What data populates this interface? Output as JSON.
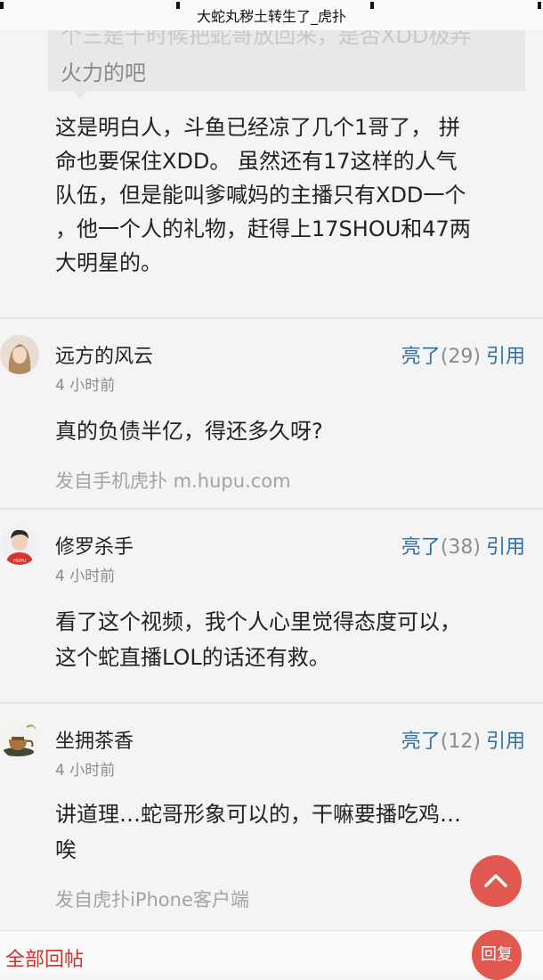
{
  "header": {
    "title": "大蛇丸秽土转生了_虎扑"
  },
  "quoted_post": {
    "faded_line": "个三是千时候把蛇哥放回来，是否XDD极弄",
    "visible_line": "火力的吧"
  },
  "main_reply": {
    "lines": [
      "这是明白人，斗鱼已经凉了几个1哥了， 拼",
      "命也要保住XDD。 虽然还有17这样的人气",
      "队伍，但是能叫爹喊妈的主播只有XDD一个",
      "，他一个人的礼物，赶得上17SHOU和47两",
      "大明星的。"
    ]
  },
  "replies": [
    {
      "username": "远方的风云",
      "time": "4 小时前",
      "light_label": "亮了",
      "light_count": "(29)",
      "quote_label": "引用",
      "content": [
        "真的负债半亿，得还多久呀?"
      ],
      "source": "发自手机虎扑 m.hupu.com"
    },
    {
      "username": "修罗杀手",
      "time": "4 小时前",
      "light_label": "亮了",
      "light_count": "(38)",
      "quote_label": "引用",
      "content": [
        "看了这个视频，我个人心里觉得态度可以，",
        "这个蛇直播LOL的话还有救。"
      ],
      "source": ""
    },
    {
      "username": "坐拥茶香",
      "time": "4 小时前",
      "light_label": "亮了",
      "light_count": "(12)",
      "quote_label": "引用",
      "content": [
        "讲道理…蛇哥形象可以的，干嘛要播吃鸡…",
        "唉"
      ],
      "source": "发自虎扑iPhone客户端"
    }
  ],
  "avatar_badge": "HUPU",
  "bottom_bar": {
    "all_posts_label": "全部回帖",
    "reply_label": "回复"
  },
  "icons": {
    "scroll_top": "chevron-up-icon"
  },
  "colors": {
    "link": "#2f6fa8",
    "accent": "#e0584f",
    "all_posts": "#d0302b"
  }
}
